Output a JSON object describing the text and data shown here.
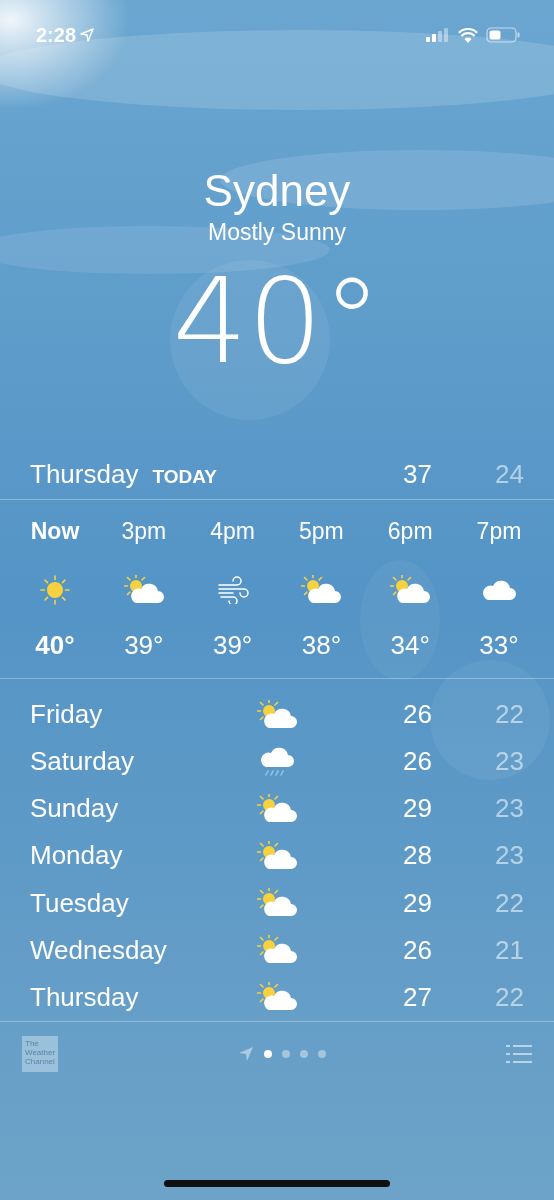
{
  "status_bar": {
    "time": "2:28"
  },
  "header": {
    "city": "Sydney",
    "condition": "Mostly Sunny",
    "temperature": "40°"
  },
  "today": {
    "day": "Thursday",
    "label": "TODAY",
    "high": "37",
    "low": "24"
  },
  "hourly": [
    {
      "time": "Now",
      "kind": "sunny",
      "temp": "40°",
      "selected": true
    },
    {
      "time": "3pm",
      "kind": "partly-cloudy",
      "temp": "39°",
      "selected": false
    },
    {
      "time": "4pm",
      "kind": "windy",
      "temp": "39°",
      "selected": false
    },
    {
      "time": "5pm",
      "kind": "partly-cloudy",
      "temp": "38°",
      "selected": false
    },
    {
      "time": "6pm",
      "kind": "partly-cloudy",
      "temp": "34°",
      "selected": false
    },
    {
      "time": "7pm",
      "kind": "cloudy",
      "temp": "33°",
      "selected": false
    }
  ],
  "daily": [
    {
      "day": "Friday",
      "kind": "partly-cloudy",
      "high": "26",
      "low": "22"
    },
    {
      "day": "Saturday",
      "kind": "rain",
      "high": "26",
      "low": "23"
    },
    {
      "day": "Sunday",
      "kind": "partly-cloudy",
      "high": "29",
      "low": "23"
    },
    {
      "day": "Monday",
      "kind": "partly-cloudy",
      "high": "28",
      "low": "23"
    },
    {
      "day": "Tuesday",
      "kind": "partly-cloudy",
      "high": "29",
      "low": "22"
    },
    {
      "day": "Wednesday",
      "kind": "partly-cloudy",
      "high": "26",
      "low": "21"
    },
    {
      "day": "Thursday",
      "kind": "partly-cloudy",
      "high": "27",
      "low": "22"
    }
  ],
  "footer": {
    "logo_text": "The Weather Channel",
    "pages": [
      {
        "selected": true
      },
      {
        "selected": false
      },
      {
        "selected": false
      },
      {
        "selected": false
      }
    ]
  }
}
